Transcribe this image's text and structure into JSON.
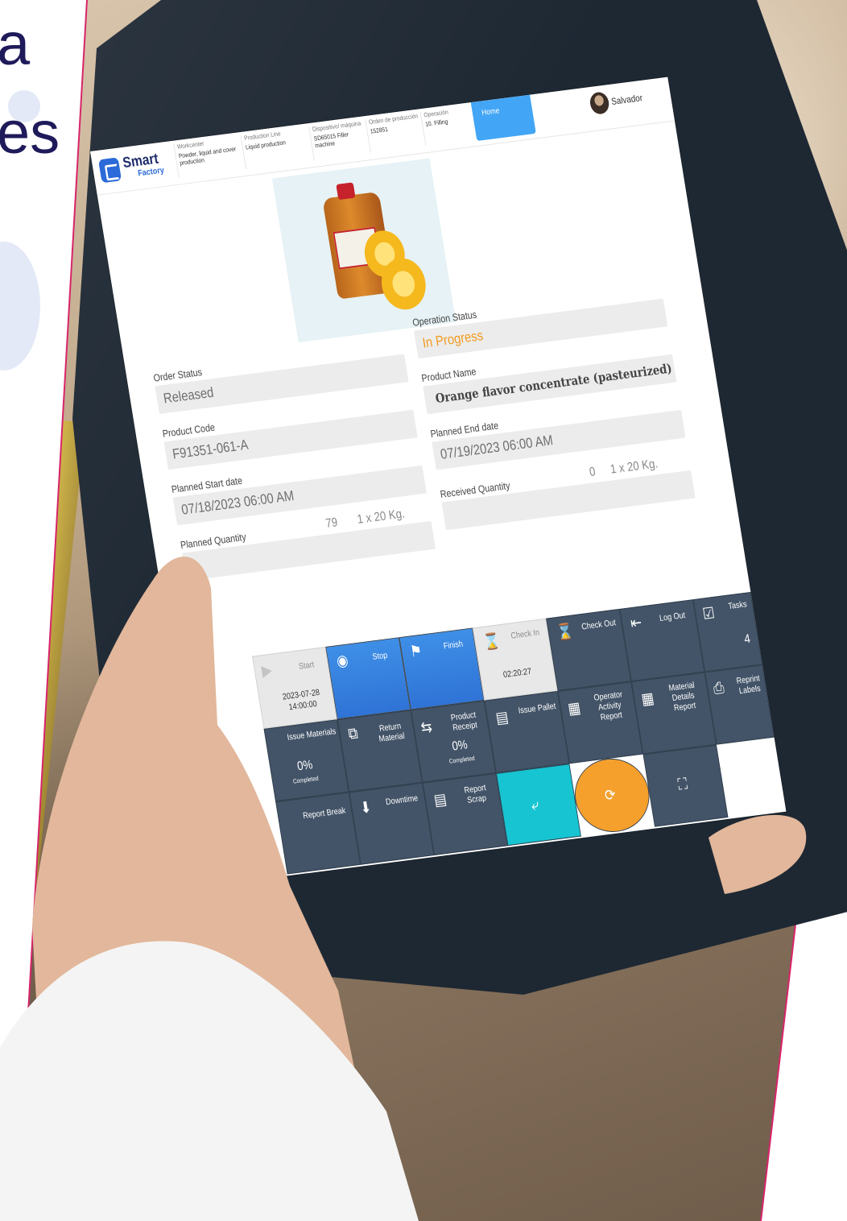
{
  "decor": {
    "heading_fragment_1": "a",
    "heading_fragment_2": "es"
  },
  "header": {
    "logo_smart": "Smart",
    "logo_factory": "Factory",
    "workcenter": {
      "label": "Workcenter",
      "value": "Powder, liquid and cover production"
    },
    "production_line": {
      "label": "Production Line",
      "value": "Liquid production"
    },
    "device": {
      "label": "Dispositivo/ máquina",
      "value": "SD65015 Filler machine"
    },
    "production_order": {
      "label": "Orden de producción",
      "value": "152851"
    },
    "operation": {
      "label": "Operación",
      "value": "10. Filling"
    },
    "home_tab": "Home",
    "user_name": "Salvador"
  },
  "fields": {
    "operation_status": {
      "label": "Operation Status",
      "value": "In Progress"
    },
    "order_status": {
      "label": "Order Status",
      "value": "Released"
    },
    "product_name": {
      "label": "Product Name",
      "value": "Orange flavor concentrate (pasteurized)"
    },
    "product_code": {
      "label": "Product Code",
      "value": "F91351-061-A"
    },
    "planned_end_date": {
      "label": "Planned End date",
      "value": "07/19/2023 06:00 AM"
    },
    "planned_start_date": {
      "label": "Planned Start date",
      "value": "07/18/2023 06:00 AM"
    },
    "received_quantity": {
      "label": "Received Quantity",
      "value": "0",
      "unit": "1 x 20 Kg."
    },
    "planned_quantity": {
      "label": "Planned Quantity",
      "value": "79",
      "unit": "1 x 20 Kg."
    }
  },
  "tiles": {
    "start": {
      "label": "Start",
      "date": "2023-07-28",
      "time": "14:00:00"
    },
    "stop": {
      "label": "Stop"
    },
    "finish": {
      "label": "Finish"
    },
    "check_in": {
      "label": "Check In",
      "time": "02:20:27"
    },
    "check_out": {
      "label": "Check Out"
    },
    "log_out": {
      "label": "Log Out"
    },
    "tasks": {
      "label": "Tasks",
      "count": "4"
    },
    "issue_materials": {
      "label": "Issue Materials",
      "pct": "0%",
      "sub": "Completed"
    },
    "return_material": {
      "label": "Return Material"
    },
    "product_receipt": {
      "label": "Product Receipt",
      "pct": "0%",
      "sub": "Completed"
    },
    "issue_pallet": {
      "label": "Issue Pallet"
    },
    "operator_activity_report": {
      "label": "Operator Activity Report"
    },
    "material_details_report": {
      "label": "Material Details Report"
    },
    "reprint_labels": {
      "label": "Reprint Labels"
    },
    "report_break": {
      "label": "Report Break"
    },
    "downtime": {
      "label": "Downtime"
    },
    "report_scrap": {
      "label": "Report Scrap"
    }
  },
  "colors": {
    "tile_dark": "#435468",
    "tile_blue": "#2f73d6",
    "tile_cyan": "#17c4d2",
    "tile_orange": "#f5a02d",
    "status_orange": "#f39a1d",
    "header_home": "#42a5f5",
    "heading_navy": "#1f1a5a",
    "edge_magenta": "#d8246a"
  }
}
